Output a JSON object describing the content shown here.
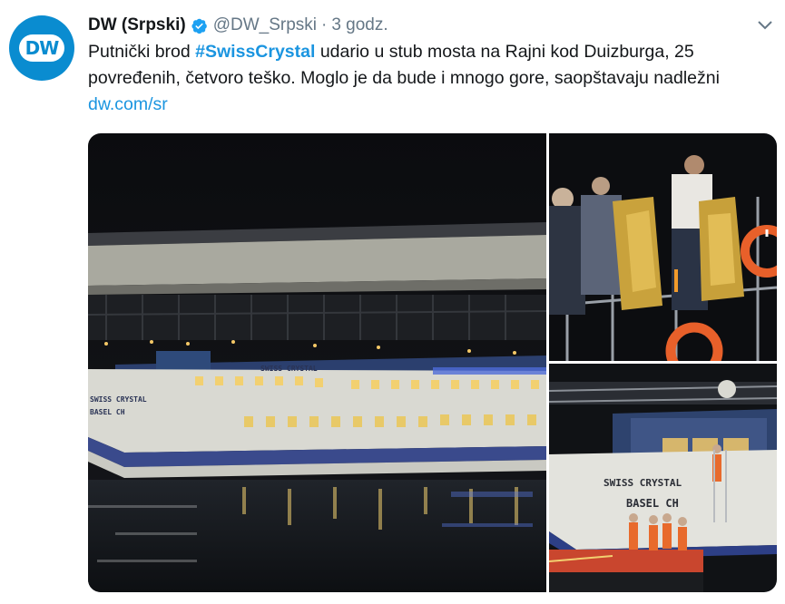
{
  "tweet": {
    "author": {
      "display_name": "DW (Srpski)",
      "handle": "@DW_Srpski",
      "verified": true,
      "avatar_icon": "dw-logo",
      "avatar_text": "DW",
      "avatar_color": "#0a8cd0"
    },
    "separator": "·",
    "time": "3 godz.",
    "text": {
      "before": "Putnički brod ",
      "hashtag": "#SwissCrystal",
      "after": " udario u stub mosta na Rajni kod Duizburga, 25 povređenih, četvoro teško. Moglo je da bude i mnogo gore, saopštavaju nadležni",
      "link": "dw.com/sr"
    },
    "menu_icon": "chevron-down-icon",
    "link_color": "#1b95e0"
  },
  "media": {
    "photos": [
      {
        "name": "ship-under-bridge",
        "ship_name": "SWISS CRYSTAL",
        "bow_label_1": "SWISS CRYSTAL",
        "bow_label_2": "BASEL CH"
      },
      {
        "name": "rescuers-with-thermal-blankets"
      },
      {
        "name": "ship-bow-closeup",
        "bow_label_1": "SWISS CRYSTAL",
        "bow_label_2": "BASEL CH"
      }
    ]
  }
}
